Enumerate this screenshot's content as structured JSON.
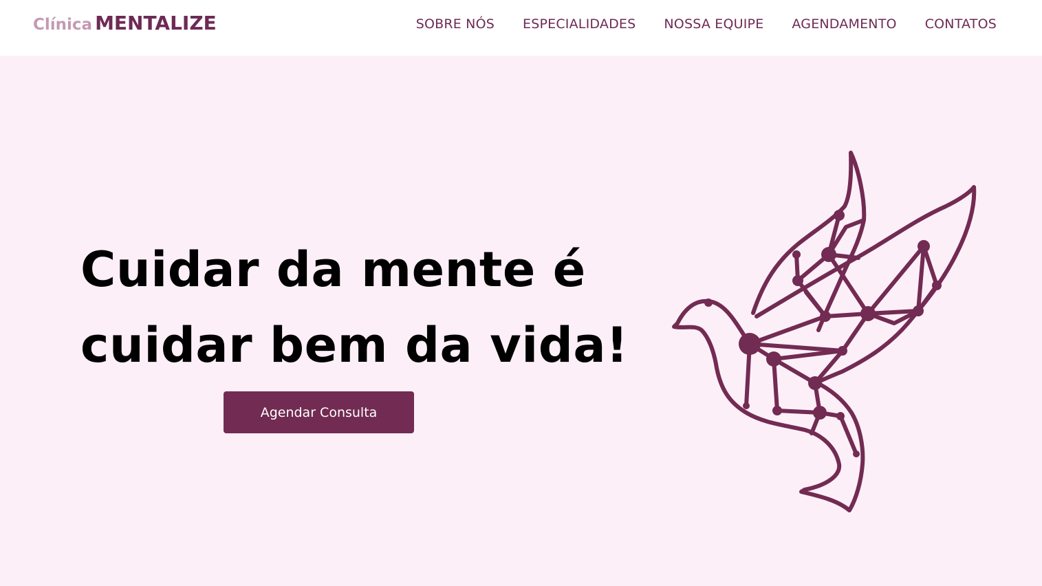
{
  "header": {
    "logo_prefix": "Clínica",
    "logo_name": "MENTALIZE",
    "nav": [
      {
        "label": "SOBRE NÓS"
      },
      {
        "label": "ESPECIALIDADES"
      },
      {
        "label": "NOSSA EQUIPE"
      },
      {
        "label": "AGENDAMENTO"
      },
      {
        "label": "CONTATOS"
      }
    ]
  },
  "hero": {
    "headline_line1": "Cuidar da mente é",
    "headline_line2": "cuidar bem da vida!",
    "cta_label": "Agendar Consulta",
    "illustration": "geometric-hummingbird-icon"
  },
  "colors": {
    "brand": "#722b52",
    "brand_light": "#c59ab3",
    "hero_bg": "#fdeff8"
  }
}
